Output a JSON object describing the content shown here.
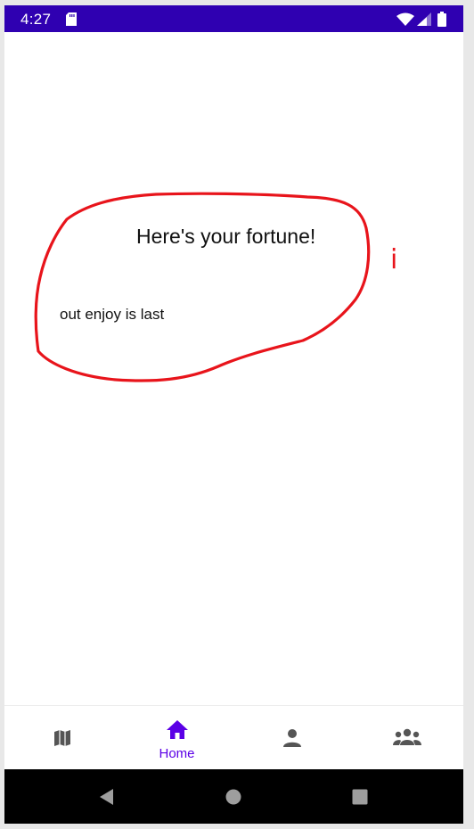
{
  "status_bar": {
    "time": "4:27",
    "icons": [
      "sd-card-icon",
      "wifi-icon",
      "signal-icon",
      "battery-icon"
    ],
    "background": "#2f00b1"
  },
  "main": {
    "title": "Here's your fortune!",
    "fortune": "out enjoy is last",
    "info_mark": "i",
    "annotation_color": "#e8141b"
  },
  "bottom_nav": {
    "items": [
      {
        "icon": "map-icon",
        "label": ""
      },
      {
        "icon": "home-icon",
        "label": "Home",
        "selected": true
      },
      {
        "icon": "person-icon",
        "label": ""
      },
      {
        "icon": "group-icon",
        "label": ""
      }
    ],
    "selected_color": "#5b00e6",
    "icon_color": "#555555"
  },
  "system_nav": {
    "icons": [
      "back-icon",
      "home-circle-icon",
      "recents-icon"
    ]
  }
}
